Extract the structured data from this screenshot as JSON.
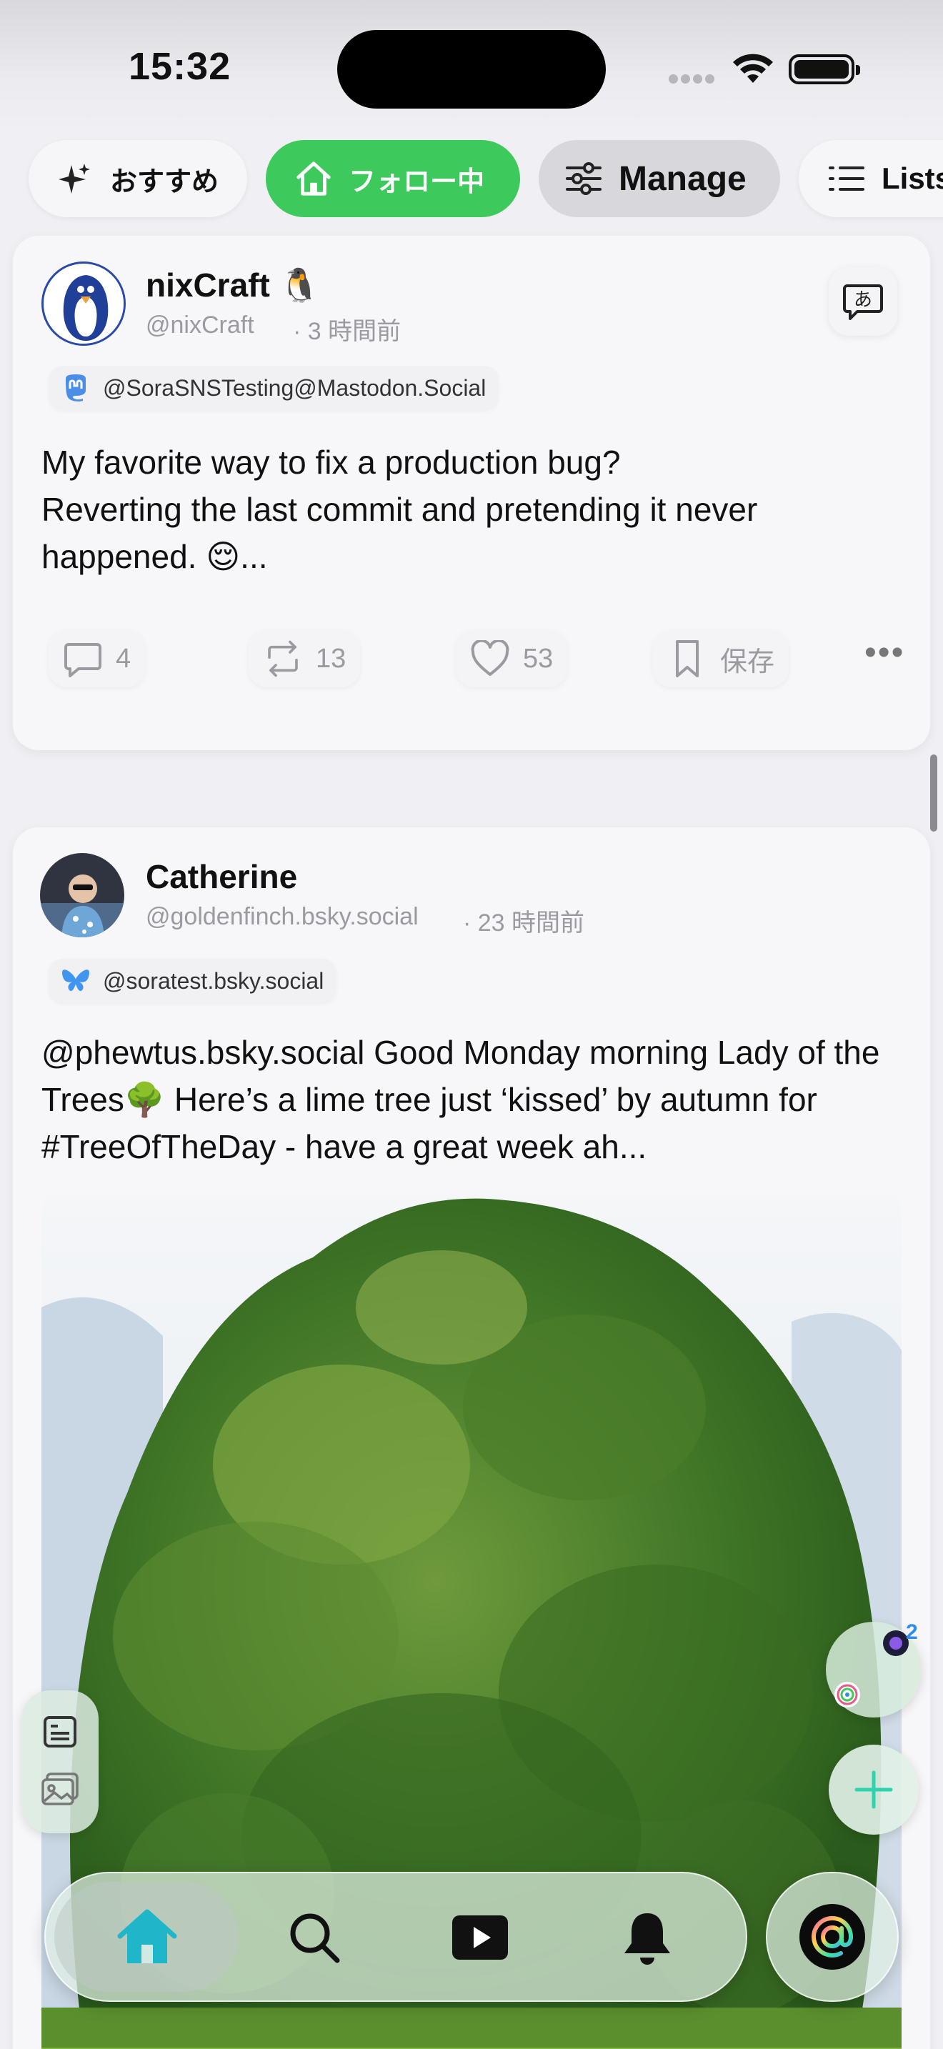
{
  "status_bar": {
    "time": "15:32"
  },
  "tabs": [
    {
      "label": "おすすめ",
      "icon": "sparkle-icon"
    },
    {
      "label": "フォロー中",
      "icon": "home-icon",
      "active": true
    },
    {
      "label": "Manage",
      "icon": "sliders-icon"
    },
    {
      "label": "Lists",
      "icon": "list-icon"
    }
  ],
  "posts": [
    {
      "display_name": "nixCraft 🐧",
      "handle": "@nixCraft",
      "time": "· 3 時間前",
      "account_chip": "@SoraSNSTesting@Mastodon.Social",
      "translate_icon": "あ",
      "text": "My favorite way to fix a production bug?\nReverting the last commit and pretending it never happened. 😌...",
      "actions": {
        "replies": "4",
        "reposts": "13",
        "likes": "53",
        "save_label": "保存"
      },
      "more": "•••"
    },
    {
      "display_name": "Catherine",
      "handle": "@goldenfinch.bsky.social",
      "time": "· 23 時間前",
      "account_chip": "@soratest.bsky.social",
      "text": "@phewtus.bsky.social Good Monday morning Lady of the Trees🌳 Here’s a lime tree just ‘kissed’ by autumn for #TreeOfTheDay - have a great week ah..."
    }
  ],
  "floating": {
    "account_badge": "2"
  },
  "colors": {
    "accent_green": "#3dc95b",
    "home_tab_teal": "#1fb6c9"
  }
}
